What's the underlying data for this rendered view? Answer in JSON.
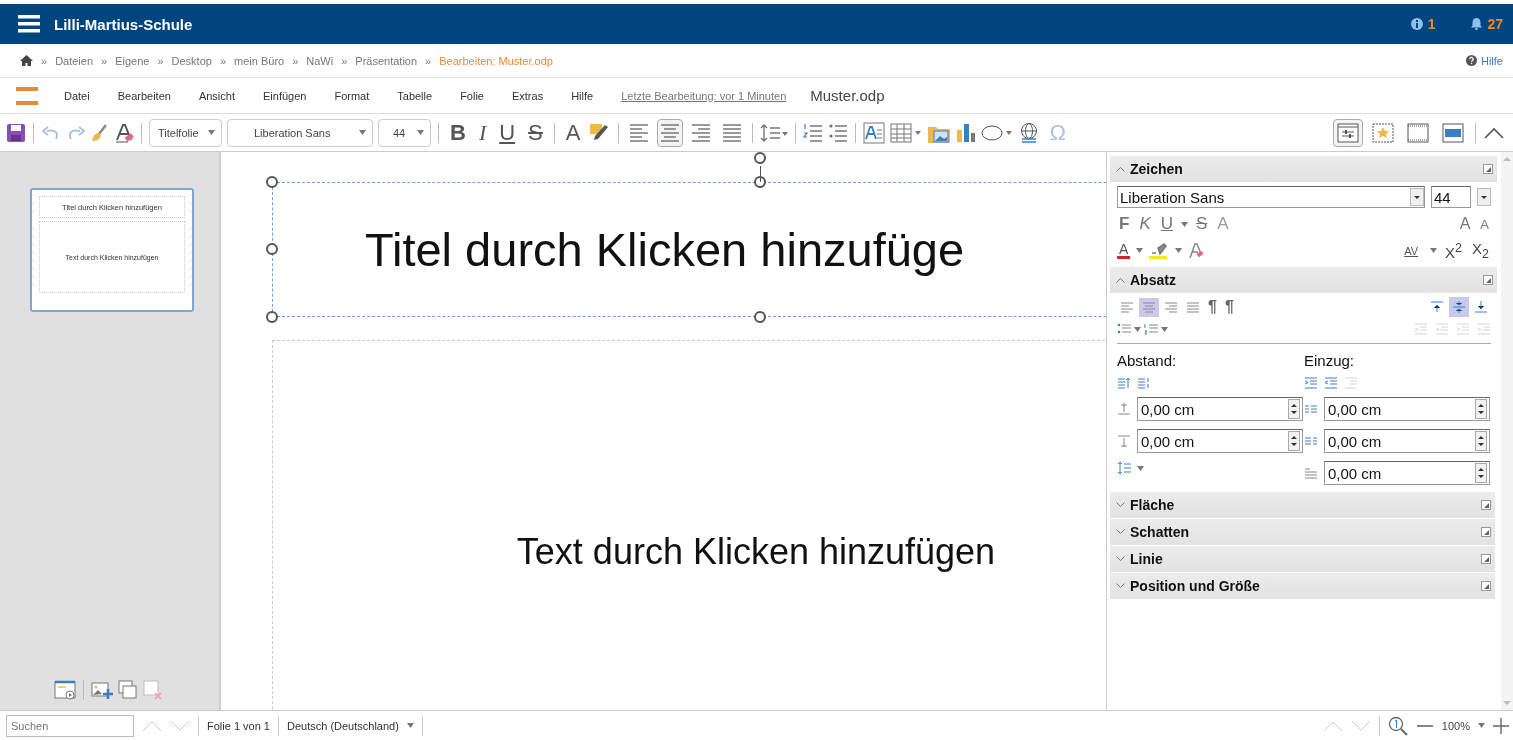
{
  "header": {
    "title": "Lilli-Martius-Schule",
    "info_count": "1",
    "notification_count": "27"
  },
  "breadcrumb": {
    "separator": "»",
    "items": [
      {
        "label": "Dateien",
        "current": false
      },
      {
        "label": "Eigene",
        "current": false
      },
      {
        "label": "Desktop",
        "current": false
      },
      {
        "label": "mein Büro",
        "current": false
      },
      {
        "label": "NaWi",
        "current": false
      },
      {
        "label": "Präsentation",
        "current": false
      },
      {
        "label": "Bearbeiten: Muster.odp",
        "current": true
      }
    ],
    "help": "Hilfe"
  },
  "menu": {
    "items": [
      "Datei",
      "Bearbeiten",
      "Ansicht",
      "Einfügen",
      "Format",
      "Tabelle",
      "Folie",
      "Extras",
      "Hilfe"
    ],
    "last_edit": "Letzte Bearbeitung: vor 1 Minuten",
    "document": "Muster.odp"
  },
  "toolbar": {
    "style": "Titelfolie",
    "font": "Liberation Sans",
    "size": "44",
    "text_buttons": [
      {
        "kind": "bold",
        "label": "B"
      },
      {
        "kind": "italic",
        "label": "I"
      },
      {
        "kind": "underline",
        "label": "U"
      },
      {
        "kind": "strike",
        "label": "S"
      },
      {
        "kind": "color",
        "label": "A"
      }
    ],
    "alignment": [
      {
        "selected": false
      },
      {
        "selected": true
      },
      {
        "selected": false
      },
      {
        "selected": false
      }
    ],
    "special": "Ω",
    "panels": [
      {
        "selected": true
      },
      {
        "selected": false
      },
      {
        "selected": false
      },
      {
        "selected": false
      }
    ]
  },
  "slides": [
    {
      "title": "Titel durch Klicken hinzufügen",
      "body": "Text durch Klicken hinzufügen",
      "selected": true
    }
  ],
  "canvas": {
    "title": "Titel durch Klicken hinzufüge",
    "body": "Text durch Klicken hinzufügen"
  },
  "sidebar": {
    "sections": [
      {
        "kind": "character",
        "title": "Zeichen",
        "expanded": true,
        "font": "Liberation Sans",
        "size": "44",
        "text_buttons": [
          {
            "kind": "bold",
            "label": "F"
          },
          {
            "kind": "italic",
            "label": "K"
          },
          {
            "kind": "underline",
            "label": "U"
          },
          {
            "kind": "strike",
            "label": "S"
          },
          {
            "kind": "shadow",
            "label": "A"
          }
        ],
        "size_buttons": [
          {
            "kind": "grow",
            "label": "A"
          },
          {
            "kind": "shrink",
            "label": "A"
          }
        ],
        "color_button": "A",
        "spacing_button": "AV",
        "script_buttons": [
          "X$^{2}$",
          "X$_{2}$"
        ]
      },
      {
        "kind": "paragraph",
        "title": "Absatz",
        "expanded": true,
        "alignment": [
          {
            "selected": false
          },
          {
            "selected": true
          },
          {
            "selected": false
          },
          {
            "selected": false
          }
        ],
        "direction_buttons": [
          "¶",
          "¶"
        ],
        "vertical": [
          {
            "selected": false
          },
          {
            "selected": true
          },
          {
            "selected": false
          }
        ],
        "spacing_label": "Abstand:",
        "indent_label": "Einzug:",
        "spacing_fields": [
          "0,00 cm",
          "0,00 cm"
        ],
        "indent_fields": [
          "0,00 cm",
          "0,00 cm",
          "0,00 cm"
        ]
      },
      {
        "title": "Fläche",
        "expanded": false
      },
      {
        "title": "Schatten",
        "expanded": false
      },
      {
        "title": "Linie",
        "expanded": false
      },
      {
        "title": "Position und Größe",
        "expanded": false
      }
    ]
  },
  "status_bar": {
    "search_placeholder": "Suchen",
    "slide_info": "Folie 1 von 1",
    "language": "Deutsch (Deutschland)",
    "zoom": "100%"
  }
}
